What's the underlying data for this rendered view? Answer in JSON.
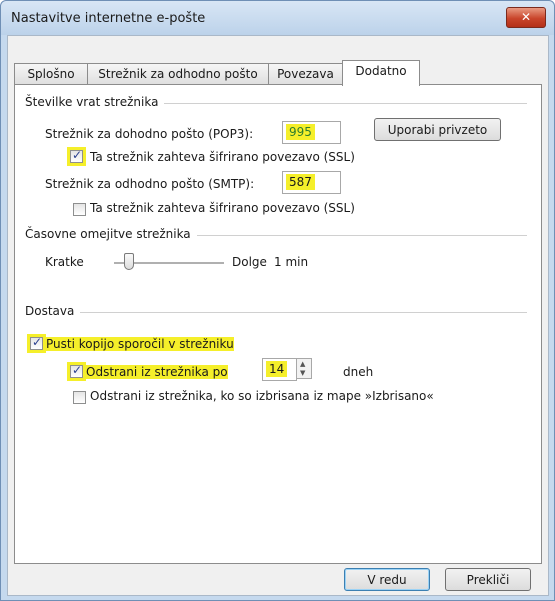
{
  "window": {
    "title": "Nastavitve internetne e-pošte",
    "close_glyph": "✕"
  },
  "tabs": [
    {
      "label": "Splošno"
    },
    {
      "label": "Strežnik za odhodno pošto"
    },
    {
      "label": "Povezava"
    },
    {
      "label": "Dodatno"
    }
  ],
  "ports": {
    "group_label": "Številke vrat strežnika",
    "incoming_label": "Strežnik za dohodno pošto (POP3):",
    "incoming_value": "995",
    "default_button": "Uporabi privzeto",
    "incoming_ssl_label": "Ta strežnik zahteva šifrirano povezavo (SSL)",
    "incoming_ssl_checked": true,
    "outgoing_label": "Strežnik za odhodno pošto (SMTP):",
    "outgoing_value": "587",
    "outgoing_ssl_label": "Ta strežnik zahteva šifrirano povezavo (SSL)",
    "outgoing_ssl_checked": false
  },
  "timeouts": {
    "group_label": "Časovne omejitve strežnika",
    "short_label": "Kratke",
    "long_label": "Dolge",
    "value_label": "1 min",
    "slider_level": 0.1
  },
  "delivery": {
    "group_label": "Dostava",
    "leave_copy_label": "Pusti kopijo sporočil v strežniku",
    "leave_copy_checked": true,
    "remove_after_label": "Odstrani iz strežnika po",
    "remove_after_checked": true,
    "days_value": "14",
    "days_unit": "dneh",
    "remove_deleted_label": "Odstrani iz strežnika, ko so izbrisana iz mape »Izbrisano«",
    "remove_deleted_checked": false
  },
  "footer": {
    "ok_label": "V redu",
    "cancel_label": "Prekliči"
  },
  "colors": {
    "highlight": "#f5ef2a",
    "selection_text": "#2e7d2e",
    "close_button": "#c9452b"
  }
}
